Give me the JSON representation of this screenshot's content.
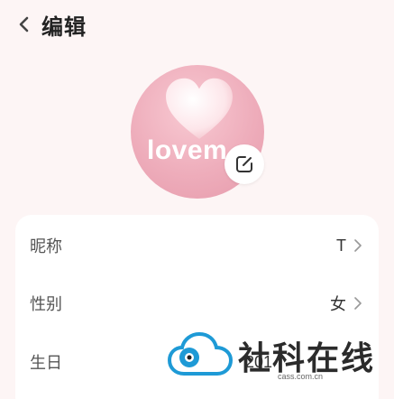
{
  "header": {
    "title": "编辑",
    "back_icon": "chevron-left-icon"
  },
  "avatar": {
    "text": "lovem",
    "edit_icon": "edit-icon",
    "background_color": "#eeadbb"
  },
  "profile": {
    "rows": [
      {
        "label": "昵称",
        "value": "T"
      },
      {
        "label": "性别",
        "value": "女"
      },
      {
        "label": "生日",
        "value": "201"
      }
    ]
  },
  "watermark": {
    "text": "社科在线",
    "sub": "cass.com.cn"
  }
}
